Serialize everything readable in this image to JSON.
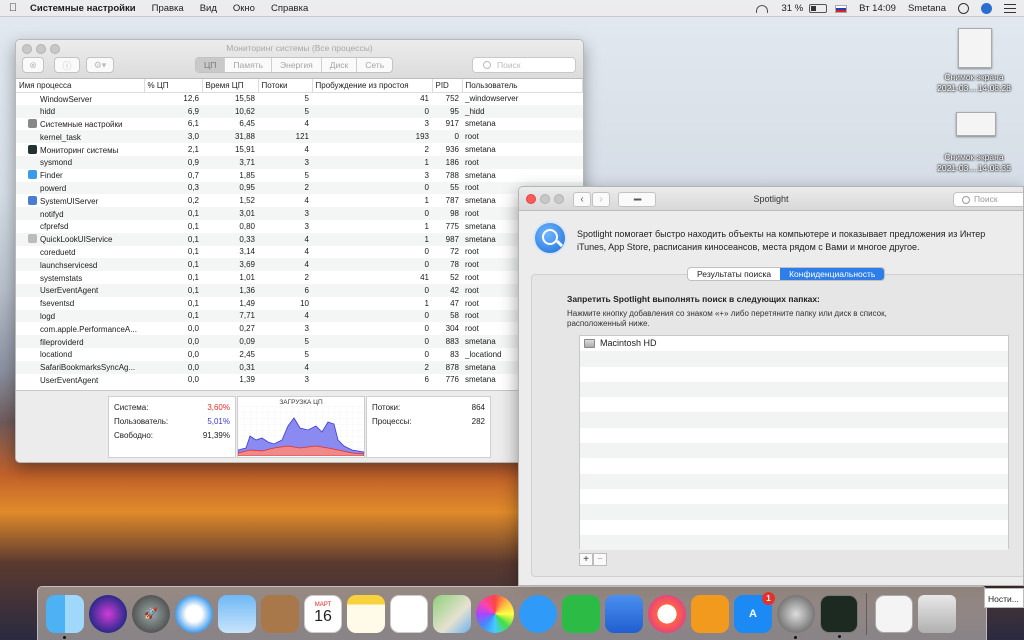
{
  "menubar": {
    "app": "Системные настройки",
    "items": [
      "Правка",
      "Вид",
      "Окно",
      "Справка"
    ],
    "battery": "31 %",
    "time": "Вт 14:09",
    "user": "Smetana"
  },
  "desktop": {
    "shots": [
      {
        "title": "Снимок экрана",
        "sub": "2021-03....14.08.28"
      },
      {
        "title": "Снимок экрана",
        "sub": "2021-03....14.08.35"
      }
    ]
  },
  "activity": {
    "title": "Мониторинг системы (Все процессы)",
    "tabs": [
      "ЦП",
      "Память",
      "Энергия",
      "Диск",
      "Сеть"
    ],
    "search_placeholder": "Поиск",
    "columns": [
      "Имя процесса",
      "% ЦП",
      "Время ЦП",
      "Потоки",
      "Пробуждение из простоя",
      "PID",
      "Пользователь"
    ],
    "rows": [
      {
        "name": "WindowServer",
        "cpu": "12,6",
        "time": "15,58",
        "threads": "5",
        "wake": "41",
        "pid": "752",
        "user": "_windowserver",
        "icon": "none"
      },
      {
        "name": "hidd",
        "cpu": "6,9",
        "time": "10,62",
        "threads": "5",
        "wake": "0",
        "pid": "95",
        "user": "_hidd",
        "icon": "none"
      },
      {
        "name": "Системные настройки",
        "cpu": "6,1",
        "time": "6,45",
        "threads": "4",
        "wake": "3",
        "pid": "917",
        "user": "smetana",
        "icon": "gear-icon"
      },
      {
        "name": "kernel_task",
        "cpu": "3,0",
        "time": "31,88",
        "threads": "121",
        "wake": "193",
        "pid": "0",
        "user": "root",
        "icon": "none"
      },
      {
        "name": "Мониторинг системы",
        "cpu": "2,1",
        "time": "15,91",
        "threads": "4",
        "wake": "2",
        "pid": "936",
        "user": "smetana",
        "icon": "monitor-icon"
      },
      {
        "name": "sysmond",
        "cpu": "0,9",
        "time": "3,71",
        "threads": "3",
        "wake": "1",
        "pid": "186",
        "user": "root",
        "icon": "none"
      },
      {
        "name": "Finder",
        "cpu": "0,7",
        "time": "1,85",
        "threads": "5",
        "wake": "3",
        "pid": "788",
        "user": "smetana",
        "icon": "finder-icon"
      },
      {
        "name": "powerd",
        "cpu": "0,3",
        "time": "0,95",
        "threads": "2",
        "wake": "0",
        "pid": "55",
        "user": "root",
        "icon": "none"
      },
      {
        "name": "SystemUIServer",
        "cpu": "0,2",
        "time": "1,52",
        "threads": "4",
        "wake": "1",
        "pid": "787",
        "user": "smetana",
        "icon": "systemui-icon"
      },
      {
        "name": "notifyd",
        "cpu": "0,1",
        "time": "3,01",
        "threads": "3",
        "wake": "0",
        "pid": "98",
        "user": "root",
        "icon": "none"
      },
      {
        "name": "cfprefsd",
        "cpu": "0,1",
        "time": "0,80",
        "threads": "3",
        "wake": "1",
        "pid": "775",
        "user": "smetana",
        "icon": "none"
      },
      {
        "name": "QuickLookUIService",
        "cpu": "0,1",
        "time": "0,33",
        "threads": "4",
        "wake": "1",
        "pid": "987",
        "user": "smetana",
        "icon": "quicklook-icon"
      },
      {
        "name": "coreduetd",
        "cpu": "0,1",
        "time": "3,14",
        "threads": "4",
        "wake": "0",
        "pid": "72",
        "user": "root",
        "icon": "none"
      },
      {
        "name": "launchservicesd",
        "cpu": "0,1",
        "time": "3,69",
        "threads": "4",
        "wake": "0",
        "pid": "78",
        "user": "root",
        "icon": "none"
      },
      {
        "name": "systemstats",
        "cpu": "0,1",
        "time": "1,01",
        "threads": "2",
        "wake": "41",
        "pid": "52",
        "user": "root",
        "icon": "none"
      },
      {
        "name": "UserEventAgent",
        "cpu": "0,1",
        "time": "1,36",
        "threads": "6",
        "wake": "0",
        "pid": "42",
        "user": "root",
        "icon": "none"
      },
      {
        "name": "fseventsd",
        "cpu": "0,1",
        "time": "1,49",
        "threads": "10",
        "wake": "1",
        "pid": "47",
        "user": "root",
        "icon": "none"
      },
      {
        "name": "logd",
        "cpu": "0,1",
        "time": "7,71",
        "threads": "4",
        "wake": "0",
        "pid": "58",
        "user": "root",
        "icon": "none"
      },
      {
        "name": "com.apple.PerformanceA...",
        "cpu": "0,0",
        "time": "0,27",
        "threads": "3",
        "wake": "0",
        "pid": "304",
        "user": "root",
        "icon": "none"
      },
      {
        "name": "fileproviderd",
        "cpu": "0,0",
        "time": "0,09",
        "threads": "5",
        "wake": "0",
        "pid": "883",
        "user": "smetana",
        "icon": "none"
      },
      {
        "name": "locationd",
        "cpu": "0,0",
        "time": "2,45",
        "threads": "5",
        "wake": "0",
        "pid": "83",
        "user": "_locationd",
        "icon": "none"
      },
      {
        "name": "SafariBookmarksSyncAg...",
        "cpu": "0,0",
        "time": "0,31",
        "threads": "4",
        "wake": "2",
        "pid": "878",
        "user": "smetana",
        "icon": "none"
      },
      {
        "name": "UserEventAgent",
        "cpu": "0,0",
        "time": "1,39",
        "threads": "3",
        "wake": "6",
        "pid": "776",
        "user": "smetana",
        "icon": "none"
      }
    ],
    "stats": {
      "system_label": "Система:",
      "system_val": "3,60%",
      "user_label": "Пользователь:",
      "user_val": "5,01%",
      "idle_label": "Свободно:",
      "idle_val": "91,39%",
      "chart_title": "ЗАГРУЗКА ЦП",
      "threads_label": "Потоки:",
      "threads_val": "864",
      "procs_label": "Процессы:",
      "procs_val": "282"
    },
    "colors": {
      "system": "#e0302a",
      "user": "#3b3bd8"
    }
  },
  "spotlight": {
    "title": "Spotlight",
    "search_placeholder": "Поиск",
    "desc1": "Spotlight помогает быстро находить объекты на компьютере и показывает предложения из Интер",
    "desc2": "iTunes, App Store, расписания киносеансов, места рядом с Вами и многое другое.",
    "tabs": [
      "Результаты поиска",
      "Конфиденциальность"
    ],
    "heading": "Запретить Spotlight выполнять поиск в следующих папках:",
    "sub": "Нажмите кнопку добавления со знаком «+» либо перетяните папку или диск в список, расположенный ниже.",
    "items": [
      "Macintosh HD"
    ],
    "add": "+",
    "remove": "−"
  },
  "dock": {
    "calendar_month": "МАРТ",
    "calendar_day": "16",
    "appstore_badge": "1",
    "edge_text": "Ности..."
  }
}
